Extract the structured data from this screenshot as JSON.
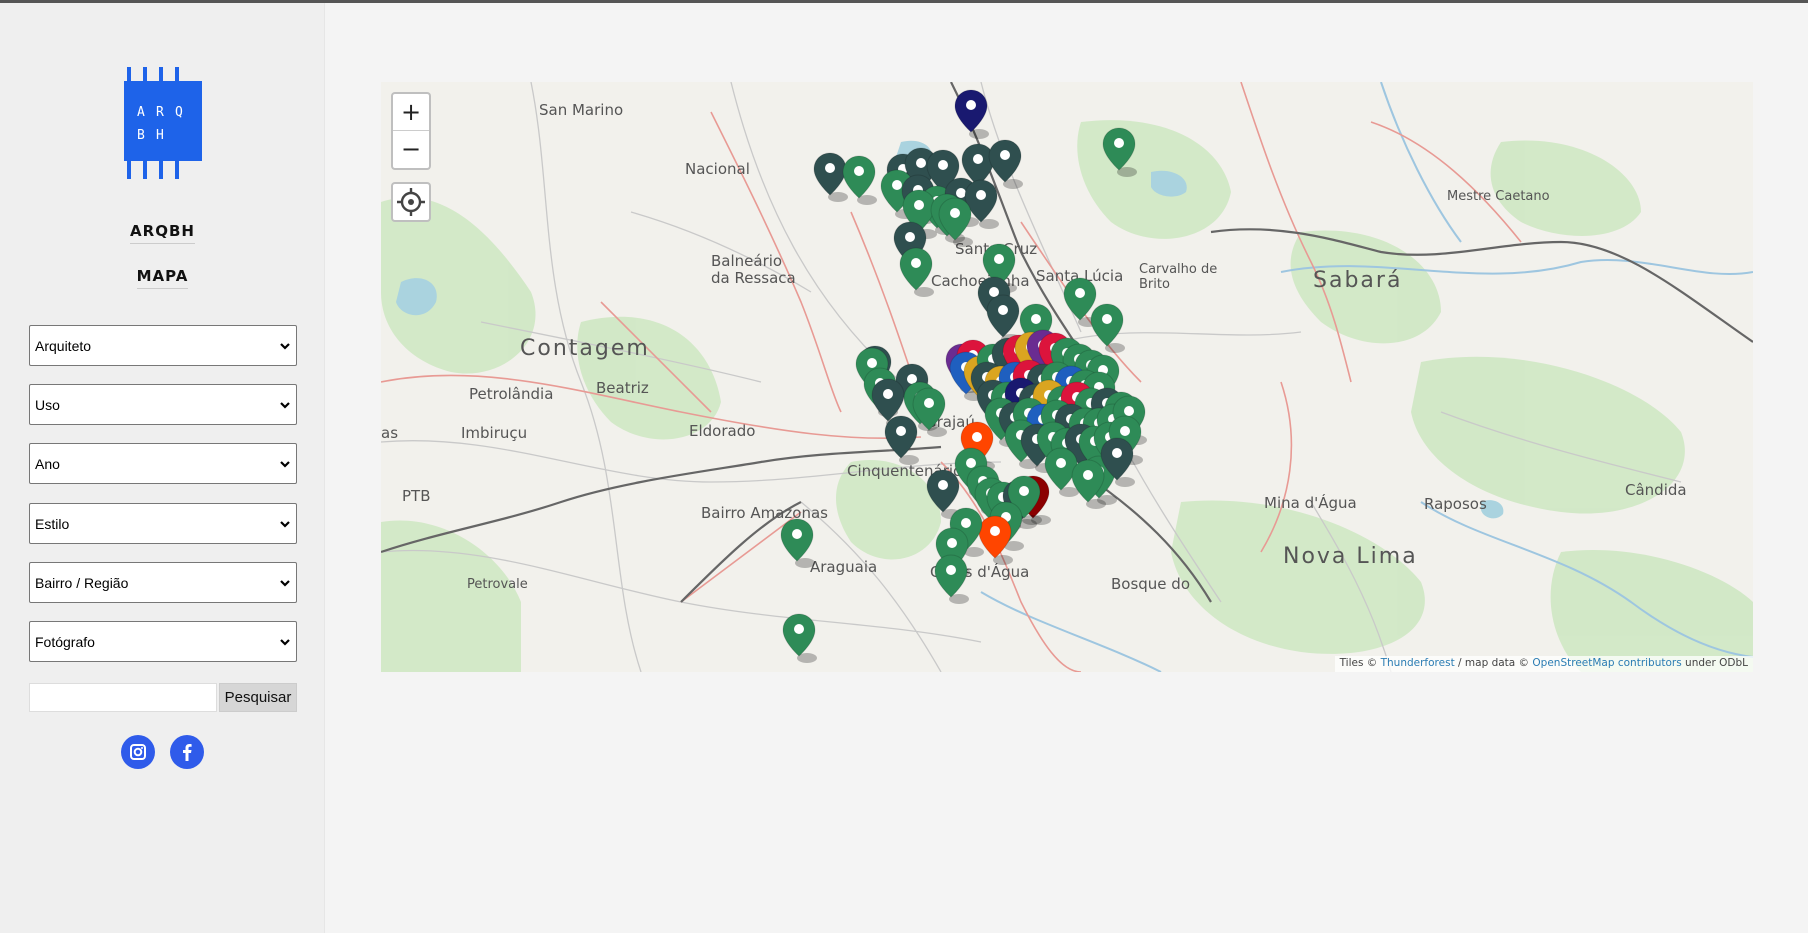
{
  "sidebar": {
    "logo_letters": [
      "A",
      "R",
      "Q",
      "B",
      "H"
    ],
    "nav": [
      {
        "label": "ARQBH"
      },
      {
        "label": "MAPA"
      }
    ],
    "filters": [
      {
        "label": "Arquiteto"
      },
      {
        "label": "Uso"
      },
      {
        "label": "Ano"
      },
      {
        "label": "Estilo"
      },
      {
        "label": "Bairro / Região"
      },
      {
        "label": "Fotógrafo"
      }
    ],
    "search": {
      "placeholder": "",
      "button_label": "Pesquisar"
    },
    "social": [
      {
        "icon": "instagram-icon"
      },
      {
        "icon": "facebook-icon"
      }
    ]
  },
  "map": {
    "controls": {
      "zoom_in": "+",
      "zoom_out": "−",
      "locate_icon": "crosshair-icon"
    },
    "attribution": {
      "prefix": "Tiles © ",
      "tiles_link": "Thunderforest",
      "middle": " / map data © ",
      "osm_link": "OpenStreetMap contributors",
      "suffix": " under ODbL"
    },
    "places": [
      {
        "name": "San Marino",
        "size": 15
      },
      {
        "name": "Nacional",
        "size": 15
      },
      {
        "name": "Mestre Caetano",
        "size": 13
      },
      {
        "name": "Balneário",
        "size": 15
      },
      {
        "name": "da Ressaca",
        "size": 15
      },
      {
        "name": "Santa Cruz",
        "size": 15
      },
      {
        "name": "Cachoeirinha",
        "size": 15
      },
      {
        "name": "Santa Lúcia",
        "size": 15
      },
      {
        "name": "Carvalho de",
        "size": 13
      },
      {
        "name": "Brito",
        "size": 13
      },
      {
        "name": "Sabará",
        "size": 22
      },
      {
        "name": "Contagem",
        "size": 22
      },
      {
        "name": "Petrolândia",
        "size": 15
      },
      {
        "name": "Beatriz",
        "size": 15
      },
      {
        "name": "Imbiruçu",
        "size": 15
      },
      {
        "name": "Eldorado",
        "size": 15
      },
      {
        "name": "Grajaú",
        "size": 15
      },
      {
        "name": "Cinquentenário",
        "size": 15
      },
      {
        "name": "PTB",
        "size": 15
      },
      {
        "name": "Bairro Amazonas",
        "size": 15
      },
      {
        "name": "Mina d'Água",
        "size": 15
      },
      {
        "name": "Raposos",
        "size": 15
      },
      {
        "name": "Cândida",
        "size": 15
      },
      {
        "name": "Nova Lima",
        "size": 22
      },
      {
        "name": "Araguaia",
        "size": 15
      },
      {
        "name": "Olhos d'Água",
        "size": 15
      },
      {
        "name": "Petrovale",
        "size": 13
      },
      {
        "name": "Bosque do",
        "size": 15
      },
      {
        "name": "as",
        "size": 15
      }
    ],
    "marker_colors": {
      "green": "#2e8b57",
      "dark": "#2f4f4f",
      "navy": "#191970",
      "orange": "#ff4500",
      "darkred": "#8b0000",
      "purple": "#6a2c91",
      "crimson": "#dc143c",
      "gold": "#daa520",
      "blue": "#1f5fbf"
    }
  }
}
